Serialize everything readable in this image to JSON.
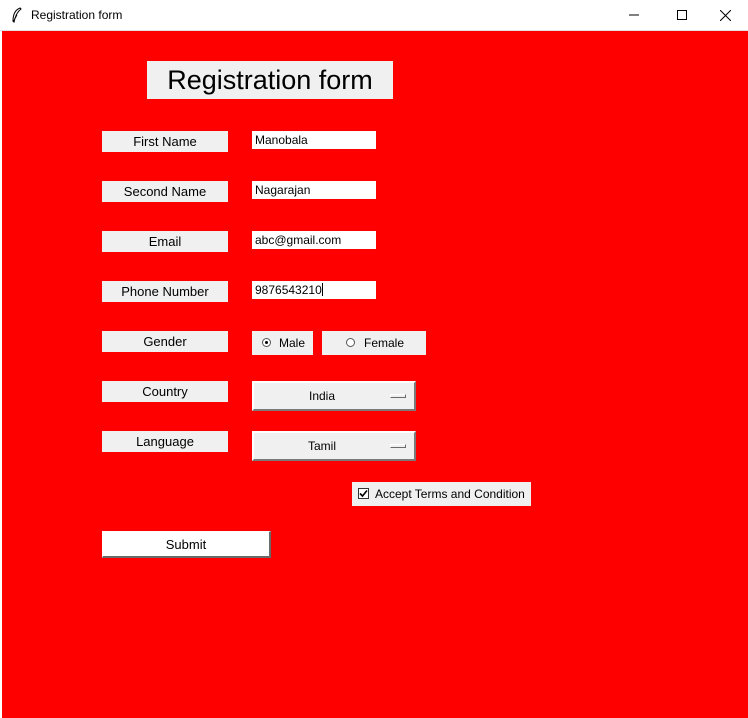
{
  "window": {
    "title": "Registration form"
  },
  "form": {
    "heading": "Registration form",
    "fields": {
      "first_name": {
        "label": "First Name",
        "value": "Manobala"
      },
      "second_name": {
        "label": "Second Name",
        "value": "Nagarajan"
      },
      "email": {
        "label": "Email",
        "value": "abc@gmail.com"
      },
      "phone": {
        "label": "Phone Number",
        "value": "9876543210"
      }
    },
    "gender": {
      "label": "Gender",
      "options": [
        "Male",
        "Female"
      ],
      "selected": "Male"
    },
    "country": {
      "label": "Country",
      "selected": "India"
    },
    "language": {
      "label": "Language",
      "selected": "Tamil"
    },
    "terms": {
      "label": "Accept Terms and Condition",
      "checked": true
    },
    "submit_label": "Submit"
  },
  "colors": {
    "background": "#ff0000",
    "widget": "#f0f0f0"
  }
}
